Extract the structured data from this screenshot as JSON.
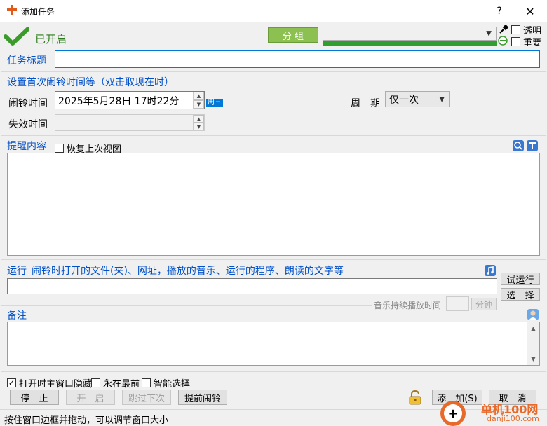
{
  "window": {
    "title": "添加任务",
    "help_label": "?",
    "close_label": "✕"
  },
  "status": {
    "enabled_text": "已开启",
    "group_button": "分 组",
    "transparent_label": "透明",
    "important_label": "重要"
  },
  "task_title": {
    "label": "任务标题",
    "value": ""
  },
  "first_alarm": {
    "section_label": "设置首次闹铃时间等（双击取现在时）",
    "alarm_time_label": "闹铃时间",
    "alarm_time_value": "2025年5月28日 17时22分",
    "weekday_badge": "周三",
    "expire_label": "失效时间",
    "expire_value": "",
    "period_label": "周　期",
    "period_value": "仅一次"
  },
  "reminder": {
    "label": "提醒内容",
    "restore_view_label": "恢复上次视图",
    "content": ""
  },
  "run": {
    "label": "运行",
    "hint": "闹铃时打开的文件(夹)、网址，播放的音乐、运行的程序、朗读的文字等",
    "value": "",
    "test_run_button": "试运行",
    "select_button": "选　择",
    "music_duration_label": "音乐持续播放时间",
    "minutes_button": "分钟"
  },
  "notes": {
    "label": "备注",
    "content": ""
  },
  "options": {
    "hide_main_label": "打开时主窗口隐藏",
    "topmost_label": "永在最前",
    "smart_select_label": "智能选择"
  },
  "buttons": {
    "stop": "停　止",
    "start": "开　启",
    "skip": "跳过下次",
    "early": "提前闹铃",
    "add": "添　加(S)",
    "cancel": "取　消"
  },
  "statusbar": {
    "text": "按住窗口边框并拖动，可以调节窗口大小"
  },
  "watermark": {
    "text1": "单机100网",
    "text2": "danji100.com"
  },
  "colors": {
    "accent_blue": "#0050c8",
    "check_green": "#3a9a2a",
    "group_green": "#8cc152",
    "progress_green": "#2fa02f"
  }
}
